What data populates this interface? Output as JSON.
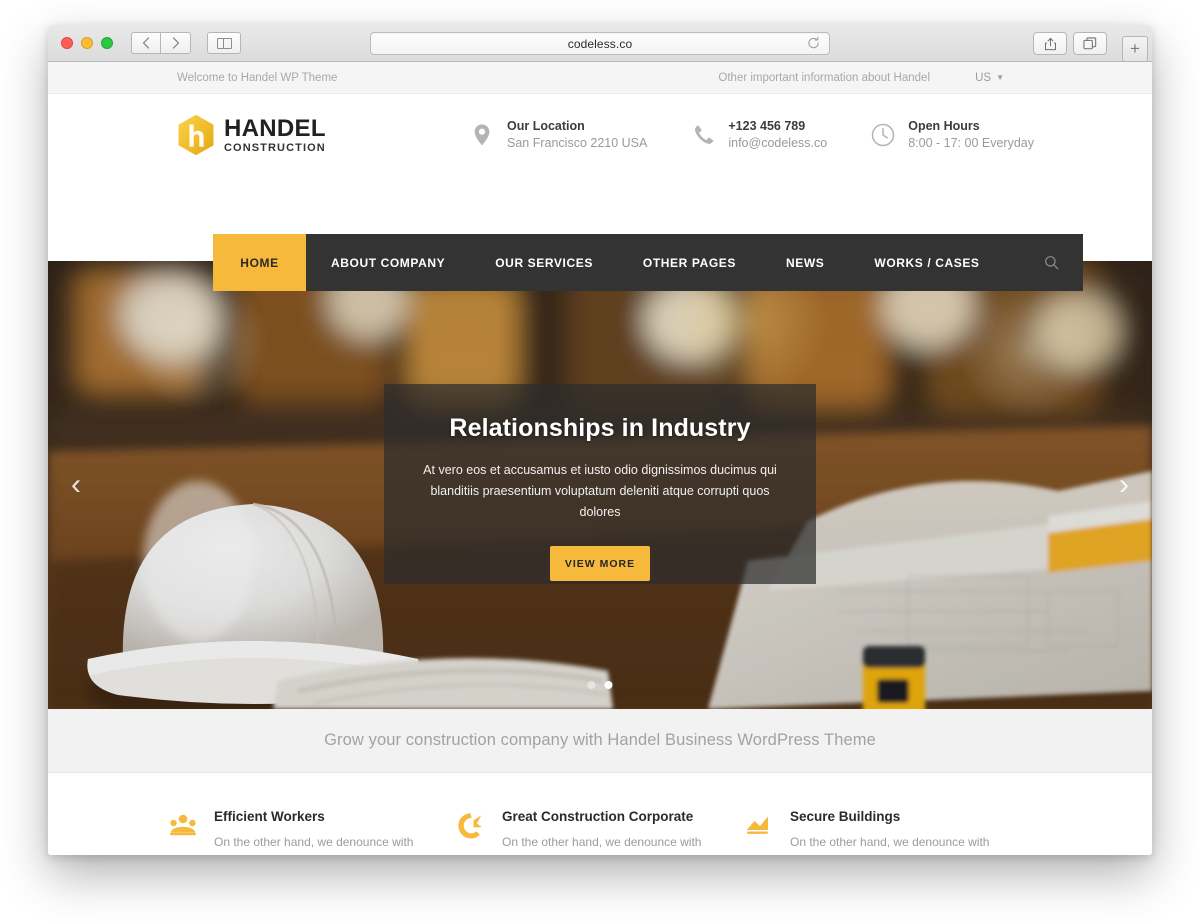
{
  "browser": {
    "url": "codeless.co",
    "reload_icon": "reload-icon",
    "back_icon": "chevron-left-icon",
    "forward_icon": "chevron-right-icon",
    "sidebar_icon": "sidebar-icon",
    "share_icon": "share-icon",
    "tabs_icon": "tabs-icon",
    "new_tab_label": "+"
  },
  "topbar": {
    "welcome": "Welcome to Handel WP Theme",
    "other_info": "Other important information about Handel",
    "language": "US"
  },
  "brand": {
    "name": "HANDEL",
    "tagline": "CONSTRUCTION"
  },
  "contacts": [
    {
      "icon": "location-pin-icon",
      "title": "Our Location",
      "sub": "San Francisco 2210 USA"
    },
    {
      "icon": "phone-icon",
      "title": "+123 456 789",
      "sub": "info@codeless.co"
    },
    {
      "icon": "clock-icon",
      "title": "Open Hours",
      "sub": "8:00 - 17: 00 Everyday"
    }
  ],
  "nav": {
    "items": [
      {
        "label": "HOME",
        "active": true
      },
      {
        "label": "ABOUT COMPANY",
        "active": false
      },
      {
        "label": "OUR SERVICES",
        "active": false
      },
      {
        "label": "OTHER PAGES",
        "active": false
      },
      {
        "label": "NEWS",
        "active": false
      },
      {
        "label": "WORKS / CASES",
        "active": false
      }
    ],
    "search_icon": "search-icon"
  },
  "hero": {
    "title": "Relationships in Industry",
    "subtitle": "At vero eos et accusamus et iusto odio dignissimos ducimus qui blanditiis praesentium voluptatum deleniti atque corrupti quos dolores",
    "button_label": "VIEW MORE",
    "prev_icon": "chevron-left-icon",
    "next_icon": "chevron-right-icon",
    "slides_total": 2,
    "active_slide": 2
  },
  "tagline": "Grow your construction company with Handel Business WordPress Theme",
  "features": [
    {
      "icon": "workers-group-icon",
      "title": "Efficient Workers",
      "text": "On the other hand, we denounce with righteous indignation and dislike men who are so beguiled"
    },
    {
      "icon": "crane-hook-icon",
      "title": "Great  Construction Corporate",
      "text": "On the other hand, we denounce with righteous indignation and dislike men who are so beguiled"
    },
    {
      "icon": "building-chart-icon",
      "title": "Secure Buildings",
      "text": "On the other hand, we denounce with righteous indignation and dislike men who are so beguiled"
    }
  ],
  "colors": {
    "accent": "#f6b93b",
    "nav_bg": "#333333",
    "text_dark": "#2b2b2b",
    "muted": "#9b9b9b"
  }
}
